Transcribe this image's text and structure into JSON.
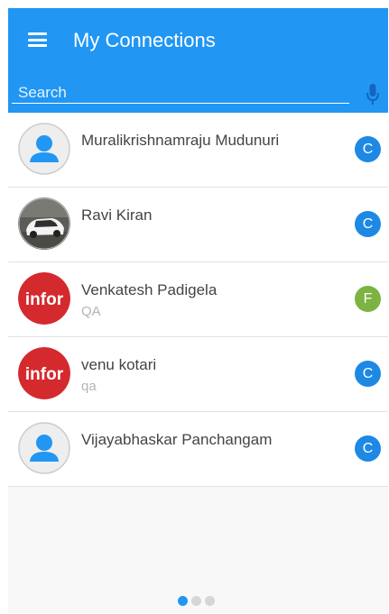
{
  "header": {
    "title": "My Connections",
    "menu_icon": "hamburger-menu-icon"
  },
  "search": {
    "placeholder": "Search",
    "value": "",
    "mic_icon": "microphone-icon"
  },
  "contacts": [
    {
      "name": "Muralikrishnamraju Mudunuri",
      "subtitle": "",
      "avatar": "default-person-icon",
      "badge": "C",
      "badge_color": "#1e88e5"
    },
    {
      "name": "Ravi Kiran",
      "subtitle": "",
      "avatar": "car-photo",
      "badge": "C",
      "badge_color": "#1e88e5"
    },
    {
      "name": "Venkatesh Padigela",
      "subtitle": "QA",
      "avatar": "infor-logo",
      "badge": "F",
      "badge_color": "#7cb342"
    },
    {
      "name": "venu kotari",
      "subtitle": "qa",
      "avatar": "infor-logo",
      "badge": "C",
      "badge_color": "#1e88e5"
    },
    {
      "name": "Vijayabhaskar Panchangam",
      "subtitle": "",
      "avatar": "default-person-icon",
      "badge": "C",
      "badge_color": "#1e88e5"
    }
  ],
  "logo_text": "infor",
  "pager": {
    "count": 3,
    "active_index": 0
  },
  "colors": {
    "primary": "#2196f3",
    "brand_red": "#d42a2e"
  }
}
